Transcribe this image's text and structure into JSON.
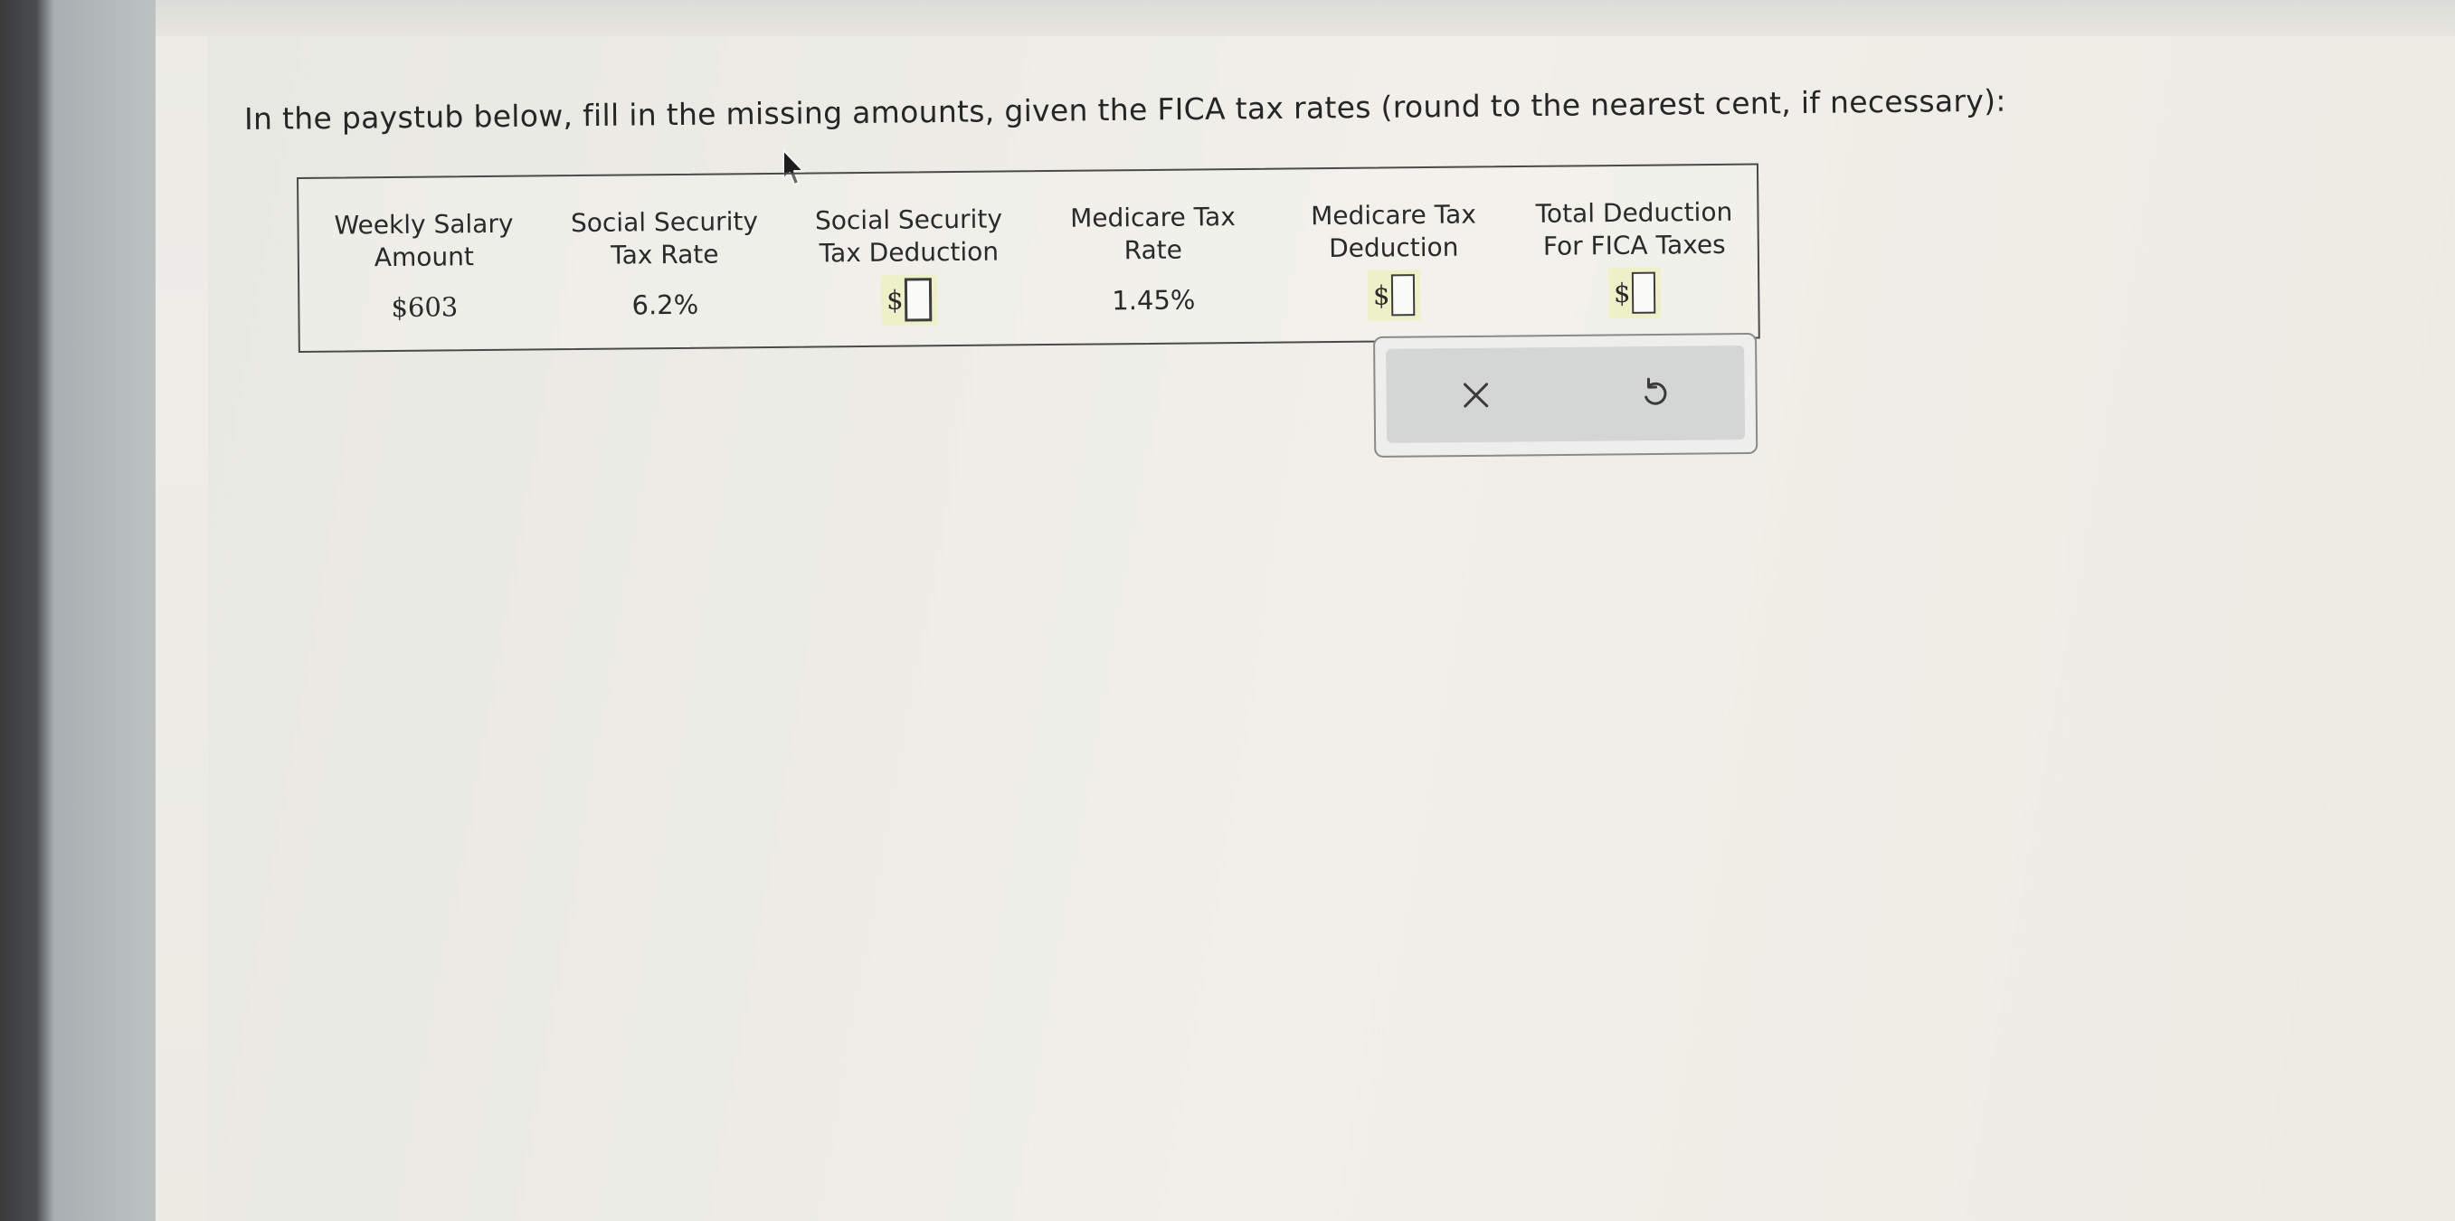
{
  "question": {
    "prompt": "In the paystub below, fill in the missing amounts, given the FICA tax rates (round to the nearest cent, if necessary):"
  },
  "paystub": {
    "columns": [
      {
        "header": "Weekly Salary\nAmount",
        "value": "$603"
      },
      {
        "header": "Social Security\nTax Rate",
        "value": "6.2%"
      },
      {
        "header": "Social Security\nTax Deduction",
        "answer_prefix": "$",
        "answer_value": ""
      },
      {
        "header": "Medicare Tax\nRate",
        "value": "1.45%"
      },
      {
        "header": "Medicare Tax\nDeduction",
        "answer_prefix": "$",
        "answer_value": ""
      },
      {
        "header": "Total Deduction\nFor FICA Taxes",
        "answer_prefix": "$",
        "answer_value": ""
      }
    ]
  },
  "actions": {
    "clear_icon": "close-icon",
    "undo_icon": "undo-icon"
  },
  "colors": {
    "answer_highlight": "#eef0c8",
    "action_bar": "#d3d6d4"
  }
}
